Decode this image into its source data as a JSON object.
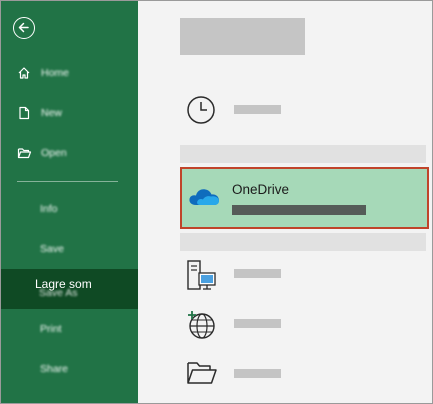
{
  "sidebar": {
    "items": [
      {
        "label": "Home",
        "icon": "home-icon"
      },
      {
        "label": "New",
        "icon": "new-document-icon"
      },
      {
        "label": "Open",
        "icon": "open-folder-icon"
      },
      {
        "label": "Info"
      },
      {
        "label": "Save"
      },
      {
        "label": "Save As",
        "overlay_label": "Lagre som",
        "selected": true
      },
      {
        "label": "Print"
      },
      {
        "label": "Share"
      }
    ]
  },
  "main": {
    "onedrive": {
      "title": "OneDrive"
    },
    "locations": [
      "recent",
      "onedrive",
      "this-pc",
      "add-a-place",
      "browse"
    ]
  },
  "colors": {
    "sidebar_bg": "#217346",
    "sidebar_selected": "#0f4a24",
    "onedrive_highlight": "#a6d9b8",
    "onedrive_border": "#c0442a",
    "onedrive_blue": "#0f6cbd"
  }
}
